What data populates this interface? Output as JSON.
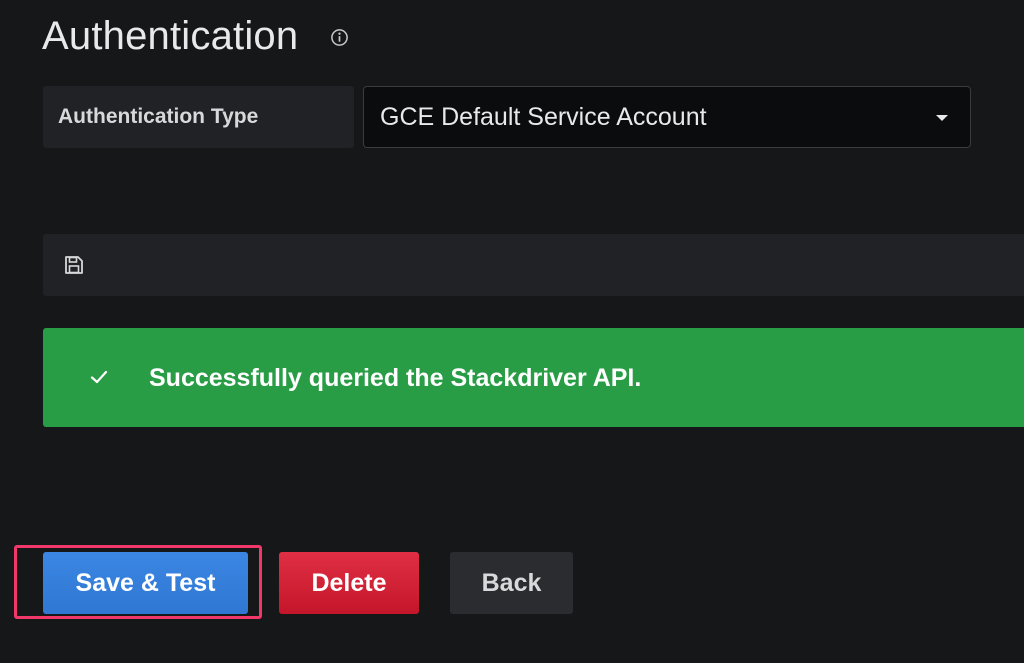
{
  "section": {
    "title": "Authentication"
  },
  "auth": {
    "label": "Authentication Type",
    "selected_value": "GCE Default Service Account"
  },
  "alert": {
    "status": "success",
    "message": "Successfully queried the Stackdriver API."
  },
  "buttons": {
    "save_test": "Save & Test",
    "delete": "Delete",
    "back": "Back"
  },
  "colors": {
    "background": "#161719",
    "success": "#299c46",
    "primary": "#3b87e3",
    "danger": "#e02f44",
    "highlight": "#f0386b"
  },
  "icons": {
    "info": "info-icon",
    "save": "floppy-disk-icon",
    "check": "check-icon",
    "dropdown": "chevron-down-icon"
  }
}
